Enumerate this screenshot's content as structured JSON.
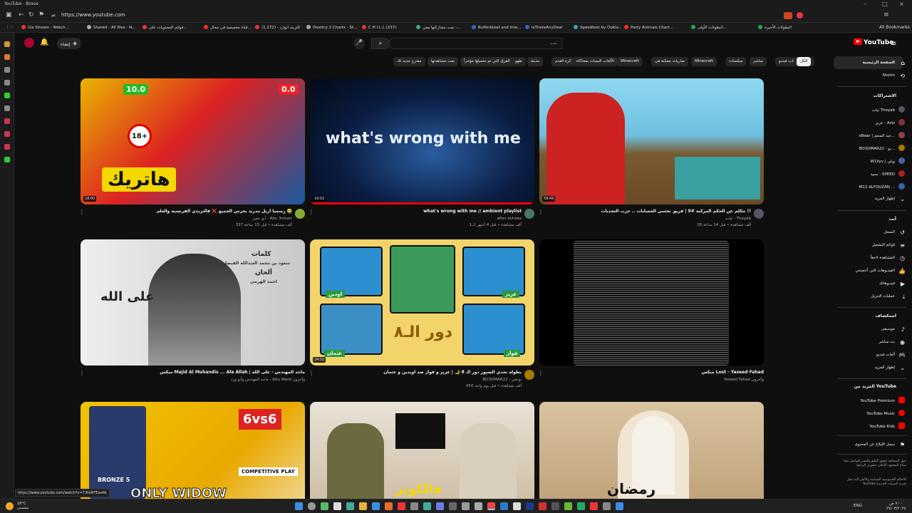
{
  "browser": {
    "title": "YouTube - Brave",
    "url": "https://www.youtube.com"
  },
  "bookmarks": [
    {
      "label": "i2a Stream - Watch..."
    },
    {
      "label": "Shared - All files - N..."
    },
    {
      "label": "قوائم المحتويات علي..."
    },
    {
      "label": "قناة مخصصة في مجال..."
    },
    {
      "label": "التريند اتوارد - (1,172)"
    },
    {
      "label": "Destiny 2 Charts - St..."
    },
    {
      "label": "C H I L L (237)"
    },
    {
      "label": "تمت مشاركتها معي -..."
    },
    {
      "label": "Bufferbloat and Inte..."
    },
    {
      "label": "IsThereAnyDeal"
    },
    {
      "label": "Speedtest by Ookla..."
    },
    {
      "label": "Party Animals Chart..."
    },
    {
      "label": "البطولات الأولى..."
    },
    {
      "label": "البطولات الأخيرة"
    }
  ],
  "all_bookmarks": "All Bookmarks",
  "youtube": {
    "logo": "YouTube",
    "search_placeholder": "بحث",
    "create": "إنشاء"
  },
  "chips": [
    "الكل",
    "موسيقى",
    "ألعاب فيديو",
    "مباشر",
    "ميكسات",
    "Minecraft",
    "مباريات ممكنة في",
    "Minecraft",
    "الألعاب السيات بمحاكاة",
    "كرة القدم",
    "مدينة",
    "طهو",
    "الفرق التي تم تحميلها مؤخراً",
    "تمت مشاهدتها",
    "مقترح جديد لك"
  ],
  "videos": [
    {
      "title": "رسمياً أزيل مدريد يخرس الجميع ❌ فالتريدي الفرنسية والعلم 🤮",
      "channel": "أبو عمير - Abu 3miser",
      "meta": "337 ألف مشاهدة • قبل 13 ساعة",
      "duration": "18:00",
      "thumb_text": "هاتريك",
      "score_left": "10.0",
      "score_right": "0.0",
      "badge": "18+"
    },
    {
      "title": "what's wrong with me // ambient playlist",
      "channel": "after echoes",
      "meta": "1.2 ألف مشاهدة • قبل 4 أشهر",
      "duration": "19:02",
      "thumb_text": "what's wrong with me"
    },
    {
      "title": "تتكلم عن الحكم المركبة #9 | فريق نحسي الحسابات .. حرب التحديات !!",
      "channel": "ثياب - Theyab",
      "meta": "28 ألف مشاهدة • قبل 14 ساعة",
      "duration": "59:49"
    },
    {
      "title": "ميكس Majid Al Muhandis ... Ala Allah | ماجد المهندس - على الله",
      "channel": "ماجد المهندس وأبو ورد - Abu Ward وآخرون",
      "meta": "",
      "duration": "",
      "thumb_text": "على الله",
      "thumb_title": "كلمات",
      "thumb_sub": "سعود بن محمد العبدالله الفيصل",
      "thumb_title2": "ألحان",
      "thumb_sub2": "احمد الهرمي"
    },
    {
      "title": "بطولة تحدي الصبور دور الـ 8 🌙 | عزيز و فواز ضد اوبدين و عثمان",
      "channel": "BO3OMAR22 - بوعمر",
      "meta": "450 ألف مشاهدة • قبل يوم واحد",
      "duration": "24:52",
      "thumb_text": "دور الـ٨",
      "names": [
        "اودين",
        "عزيز",
        "عثمان",
        "فواز"
      ]
    },
    {
      "title": "ميكس Lost - Yazeed Fahad",
      "channel": "Yazeed Fahad وآخرون",
      "meta": "",
      "duration": ""
    },
    {
      "title": "",
      "channel": "",
      "meta": "",
      "duration": "",
      "thumb_text": "ONLY WIDOW",
      "thumb_sub": "6vs6",
      "thumb_sub2": "COMPETITIVE PLAY",
      "thumb_rank": "BRONZE 5"
    },
    {
      "title": "",
      "channel": "",
      "meta": "",
      "duration": "",
      "thumb_text": "فالكونز"
    },
    {
      "title": "",
      "channel": "",
      "meta": "",
      "duration": "",
      "thumb_text": "رمضان"
    }
  ],
  "sidebar": {
    "home": "الصفحة الرئيسية",
    "shorts": "Shorts",
    "subs_header": "الاشتراكات",
    "subs": [
      {
        "name": "ثياب Theyab",
        "color": "#556"
      },
      {
        "name": "عزيز - Aziz",
        "color": "#833"
      },
      {
        "name": "xBaar | عبد المنعم...",
        "color": "#844"
      },
      {
        "name": "BO3OMAR22 - بو...",
        "color": "#a70"
      },
      {
        "name": "W1llyv | ويلي",
        "color": "#469"
      },
      {
        "name": "سبيد - SPEED",
        "color": "#a22"
      },
      {
        "name": "M12 ALFOUZAN ...",
        "color": "#36a"
      }
    ],
    "show_more": "إظهار المزيد",
    "you_header": "أنت",
    "you": [
      "السجل",
      "قوائم التشغيل",
      "المشاهدة لاحقاً",
      "الفيديوهات التي أعجبتني",
      "فيديوهاتك",
      "عمليات التنزيل"
    ],
    "explore_header": "استكشاف",
    "explore": [
      "موسيقى",
      "بث مباشر",
      "ألعاب فيديو",
      "إظهار المزيد"
    ],
    "more_header": "المزيد من YouTube",
    "more": [
      "YouTube Premium",
      "YouTube Music",
      "YouTube Kids"
    ],
    "report": "سجل الإبلاغ عن المحتوى",
    "footer": "حول  الصحافة  حقوق الطبع والنشر  التواصل معنا  صناع المحتوى  الإعلان  مطوري البرامج",
    "footer2": "الأحكام  الخصوصية  السياسة والأمان  آلية عمل YouTube  تجربة الميزات الجديدة"
  },
  "status_url": "https://www.youtube.com/watch?v=73fsWTEae6k",
  "taskbar": {
    "temp": "18°C",
    "weather": "مشمس",
    "lang": "ENG",
    "time": "٧:٠٠ ص",
    "date": "٢٧/٠٣/٢٠٢٥"
  }
}
